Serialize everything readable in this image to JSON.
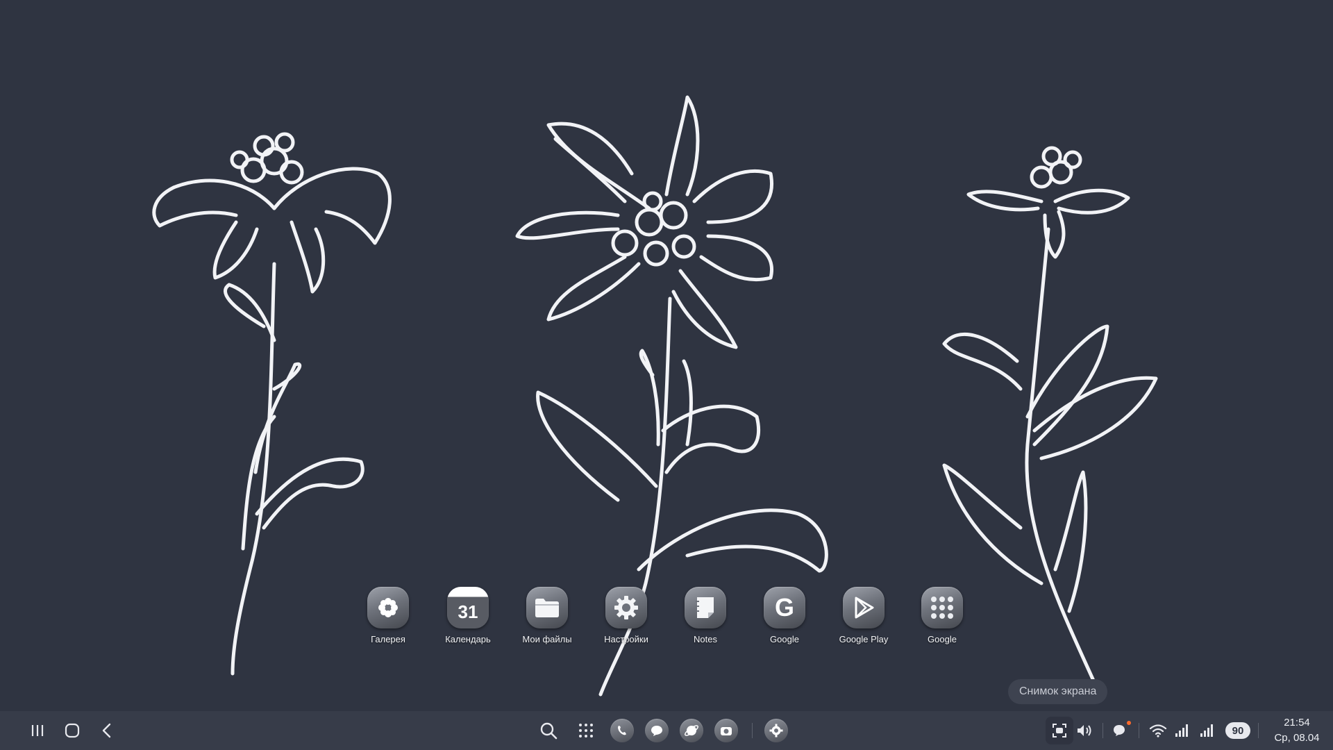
{
  "dock": {
    "apps": [
      {
        "label": "Галерея",
        "icon": "flower-icon"
      },
      {
        "label": "Календарь",
        "icon": "calendar-icon",
        "day": "31"
      },
      {
        "label": "Мои файлы",
        "icon": "folder-icon"
      },
      {
        "label": "Настройки",
        "icon": "gear-icon"
      },
      {
        "label": "Notes",
        "icon": "notes-icon"
      },
      {
        "label": "Google",
        "icon": "google-icon"
      },
      {
        "label": "Google Play",
        "icon": "play-store-icon"
      },
      {
        "label": "Google",
        "icon": "app-folder-icon"
      }
    ]
  },
  "tooltip": {
    "text": "Снимок экрана"
  },
  "taskbar": {
    "nav": [
      "recents-icon",
      "home-icon",
      "back-icon"
    ],
    "center": [
      "search-icon",
      "app-grid-icon",
      "phone-icon",
      "messages-icon",
      "internet-icon",
      "camera-icon",
      "settings-icon"
    ],
    "status": {
      "battery": "90",
      "time": "21:54",
      "date": "Ср, 08.04"
    }
  },
  "colors": {
    "background": "#2f3441",
    "taskbar": "#373c49",
    "line-art": "#f2f3f6",
    "notification": "#ff6a2b"
  }
}
